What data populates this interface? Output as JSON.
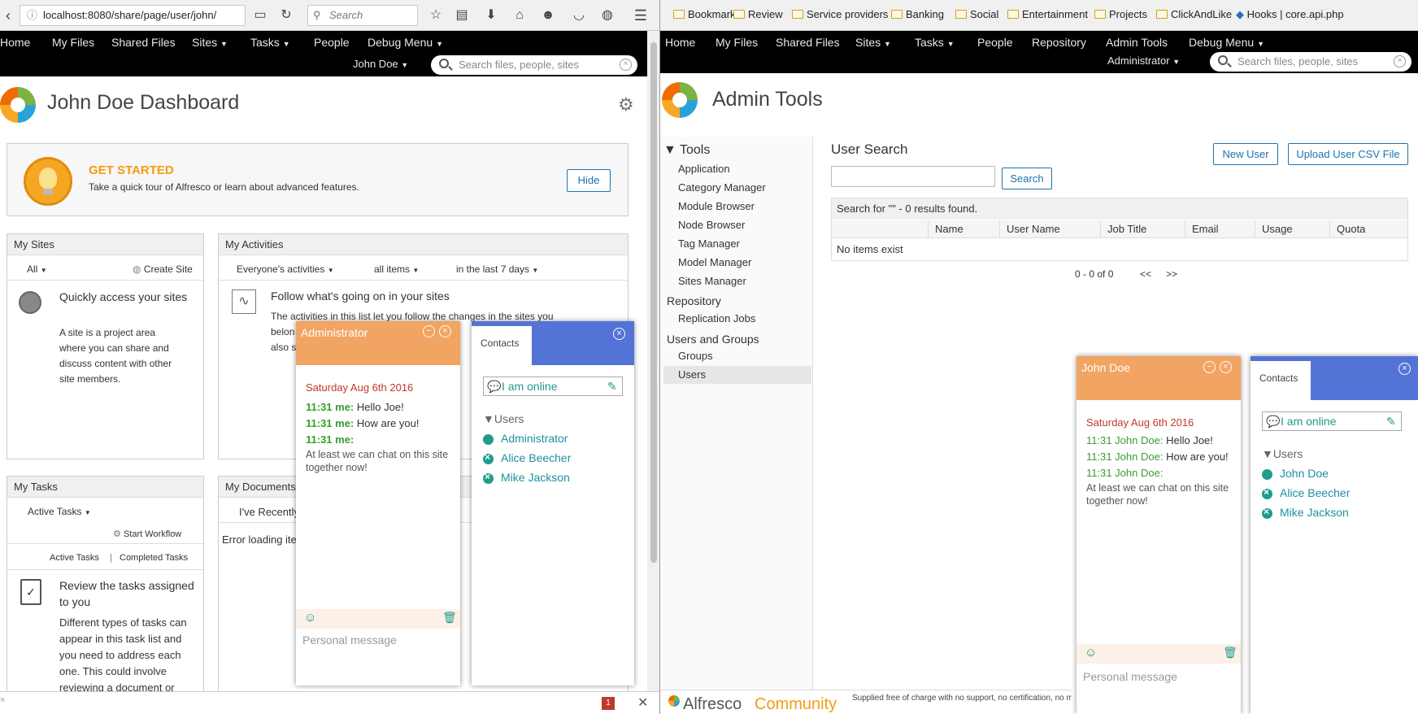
{
  "left": {
    "browser": {
      "url": "localhost:8080/share/page/user/john/",
      "search_placeholder": "Search"
    },
    "nav": {
      "items": [
        "Home",
        "My Files",
        "Shared Files",
        "Sites",
        "Tasks",
        "People",
        "Debug Menu"
      ],
      "user": "John Doe",
      "search_placeholder": "Search files, people, sites"
    },
    "title": "John Doe Dashboard",
    "get_started": {
      "heading": "GET STARTED",
      "text": "Take a quick tour of Alfresco or learn about advanced features.",
      "hide": "Hide"
    },
    "my_sites": {
      "title": "My Sites",
      "filter": "All",
      "create": "Create Site",
      "heading": "Quickly access your sites",
      "body": "A site is a project area where you can share and discuss content with other site members."
    },
    "my_activities": {
      "title": "My Activities",
      "filter1": "Everyone's activities",
      "filter2": "all items",
      "filter3": "in the last 7 days",
      "heading": "Follow what's going on in your sites",
      "body1": "The activities in this list let you follow the changes in the sites you",
      "body2": "belon",
      "body3": "also s"
    },
    "my_tasks": {
      "title": "My Tasks",
      "filter": "Active Tasks",
      "start": "Start Workflow",
      "active": "Active Tasks",
      "completed": "Completed Tasks",
      "heading": "Review the tasks assigned to you",
      "body": "Different types of tasks can appear in this task list and you need to address each one. This could involve reviewing a document or"
    },
    "my_documents": {
      "title": "My Documents",
      "filter": "I've Recently",
      "error": "Error loading ite"
    },
    "chat": {
      "title": "Administrator",
      "date": "Saturday Aug 6th 2016",
      "messages": [
        {
          "who": "11:31 me:",
          "text": "Hello Joe!"
        },
        {
          "who": "11:31 me:",
          "text": "How are you!"
        },
        {
          "who": "11:31 me:",
          "text": "At least we can chat on this site together now!"
        }
      ],
      "placeholder": "Personal message"
    },
    "contacts": {
      "tab": "Contacts",
      "status": "I am online",
      "group": "Users",
      "users": [
        "Administrator",
        "Alice Beecher",
        "Mike Jackson"
      ]
    },
    "notif_count": "1"
  },
  "right": {
    "bookmarks": [
      "Bookmarks",
      "Review",
      "Service providers",
      "Banking",
      "Social",
      "Entertainment",
      "Projects",
      "ClickAndLike",
      "Hooks | core.api.php"
    ],
    "nav": {
      "items": [
        "Home",
        "My Files",
        "Shared Files",
        "Sites",
        "Tasks",
        "People",
        "Repository",
        "Admin Tools",
        "Debug Menu"
      ],
      "user": "Administrator",
      "search_placeholder": "Search files, people, sites"
    },
    "title": "Admin Tools",
    "tools": {
      "heading": "Tools",
      "items": [
        "Application",
        "Category Manager",
        "Module Browser",
        "Node Browser",
        "Tag Manager",
        "Model Manager",
        "Sites Manager"
      ],
      "repository": "Repository",
      "repo_items": [
        "Replication Jobs"
      ],
      "users_groups": "Users and Groups",
      "ug_items": [
        "Groups",
        "Users"
      ]
    },
    "user_search": {
      "title": "User Search",
      "new_user": "New User",
      "upload": "Upload User CSV File",
      "search_btn": "Search",
      "result_text": "Search for \"\" - 0 results found.",
      "columns": [
        "Name",
        "User Name",
        "Job Title",
        "Email",
        "Usage",
        "Quota"
      ],
      "empty": "No items exist",
      "paging": "0 - 0 of 0",
      "prev": "<<",
      "next": ">>"
    },
    "chat": {
      "title": "John Doe",
      "date": "Saturday Aug 6th 2016",
      "messages": [
        {
          "who": "11:31 John Doe:",
          "text": "Hello Joe!"
        },
        {
          "who": "11:31 John Doe:",
          "text": "How are you!"
        },
        {
          "who": "11:31 John Doe:",
          "text": "At least we can chat on this site together now!"
        }
      ],
      "placeholder": "Personal message"
    },
    "contacts": {
      "tab": "Contacts",
      "status": "I am online",
      "group": "Users",
      "users": [
        "John Doe",
        "Alice Beecher",
        "Mike Jackson"
      ]
    },
    "footer": {
      "brand": "Alfresco",
      "brand2": "Community",
      "text": "Supplied free of charge with no support, no certification, no maint"
    }
  }
}
